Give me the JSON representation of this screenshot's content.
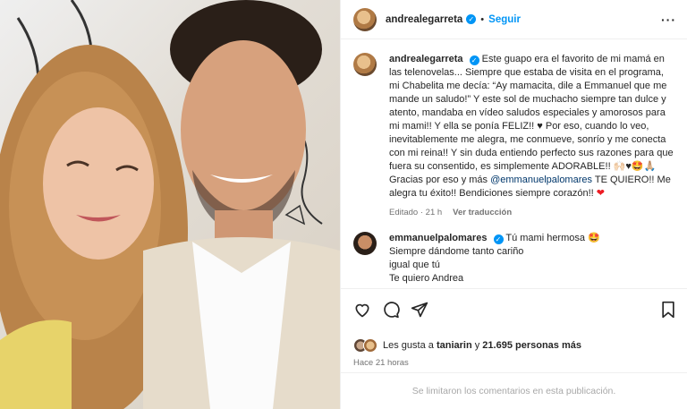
{
  "header": {
    "username": "andrealegarreta",
    "follow_label": "Seguir",
    "dot": "•",
    "more_label": "···"
  },
  "caption": {
    "username": "andrealegarreta",
    "text_part1": "Este guapo era el favorito de mi mamá en las telenovelas... Siempre que estaba de visita en el programa, mi Chabelita me decía: “Ay mamacita, dile a Emmanuel que me mande un saludo!” Y este sol de muchacho siempre tan dulce y atento, mandaba en vídeo saludos especiales y amorosos para mi mami!! Y ella se ponía FELIZ!! ♥ Por eso, cuando lo veo, inevitablemente me alegra, me conmueve, sonrío y me conecta con mi reina!! Y sin duda entiendo perfecto sus razones para que fuera su consentido, es simplemente ADORABLE!! 🙌🏻♥🤩🙏🏼 Gracias por eso y más",
    "mention": "@emmanuelpalomares",
    "text_part2": "TE QUIERO!! Me alegra tu éxito!! Bendiciones siempre corazón!!",
    "heart": "❤",
    "edited": "Editado · 21 h",
    "translate": "Ver traducción"
  },
  "comment": {
    "username": "emmanuelpalomares",
    "lines": [
      "Tú mami hermosa 🤩",
      "Siempre dándome tanto cariño",
      "igual que tú",
      "Te quiero Andrea"
    ]
  },
  "likes": {
    "prefix": "Les gusta a",
    "user": "taniarin",
    "conj": "y",
    "count": "21.695 personas más"
  },
  "time": "Hace 21 horas",
  "limited": "Se limitaron los comentarios en esta publicación."
}
